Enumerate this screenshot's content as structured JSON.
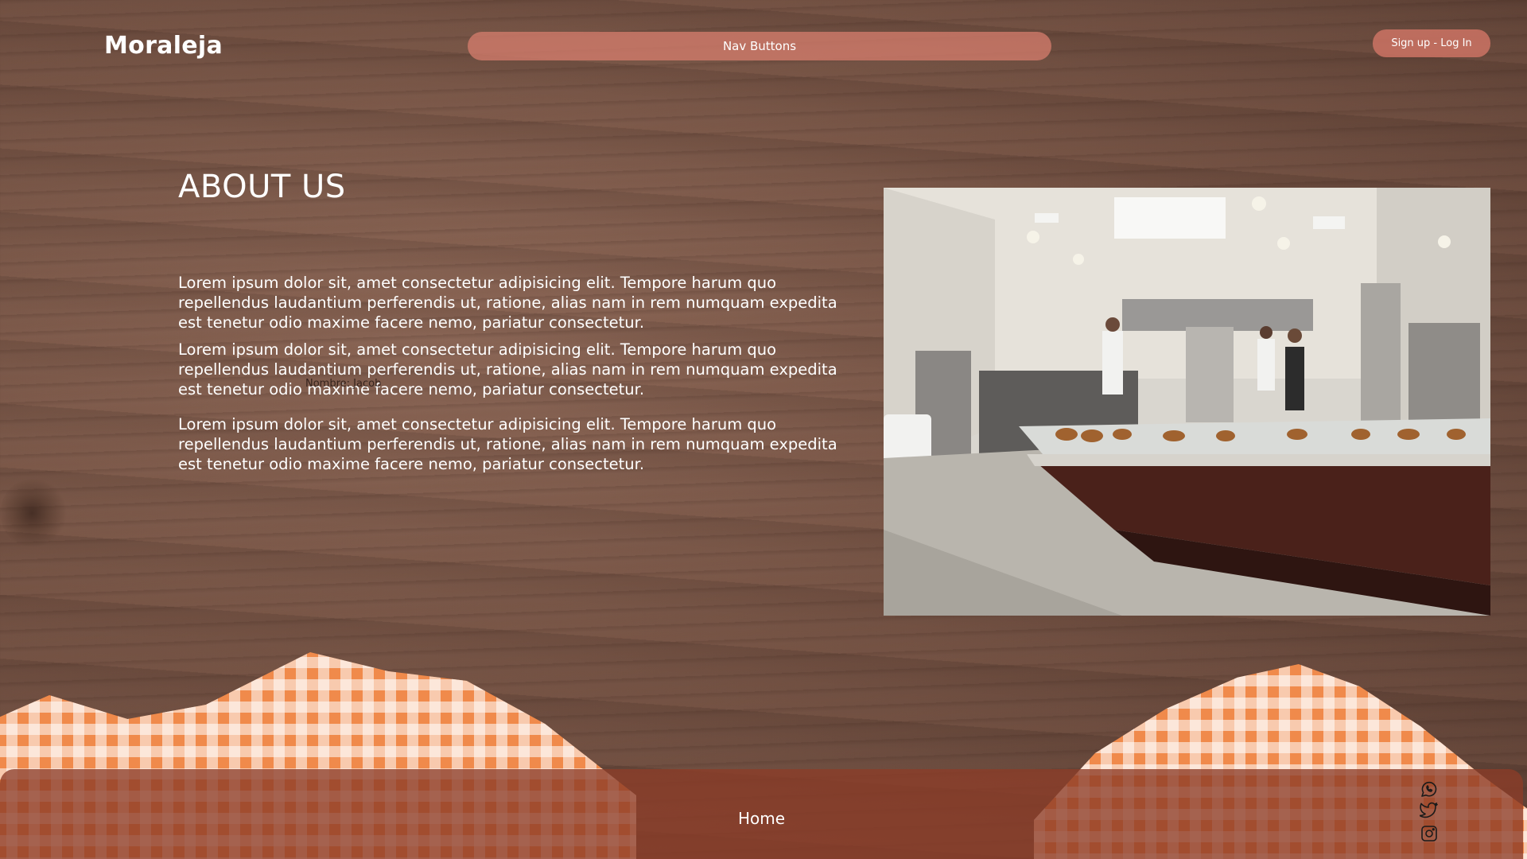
{
  "header": {
    "brand": "Moraleja",
    "nav_label": "Nav Buttons",
    "auth_label": "Sign up - Log In"
  },
  "main": {
    "title": "ABOUT US",
    "paragraphs": [
      "Lorem ipsum dolor sit, amet consectetur adipisicing elit. Tempore harum quo repellendus laudantium perferendis ut, ratione, alias nam in rem numquam expedita est tenetur odio maxime facere nemo, pariatur consectetur.",
      "Lorem ipsum dolor sit, amet consectetur adipisicing elit. Tempore harum quo repellendus laudantium perferendis ut, ratione, alias nam in rem numquam expedita est tenetur odio maxime facere nemo, pariatur consectetur.",
      "Lorem ipsum dolor sit, amet consectetur adipisicing elit. Tempore harum quo repellendus laudantium perferendis ut, ratione, alias nam in rem numquam expedita est tenetur odio maxime facere nemo, pariatur consectetur."
    ],
    "faint_label": "Nombre: Jacob"
  },
  "footer": {
    "home_label": "Home",
    "social_icons": [
      "whatsapp-icon",
      "twitter-icon",
      "instagram-icon"
    ]
  },
  "colors": {
    "wood": "#735244",
    "accent": "#d77d6e",
    "footer": "#8c3c28",
    "cloth": "#f08a4b"
  }
}
